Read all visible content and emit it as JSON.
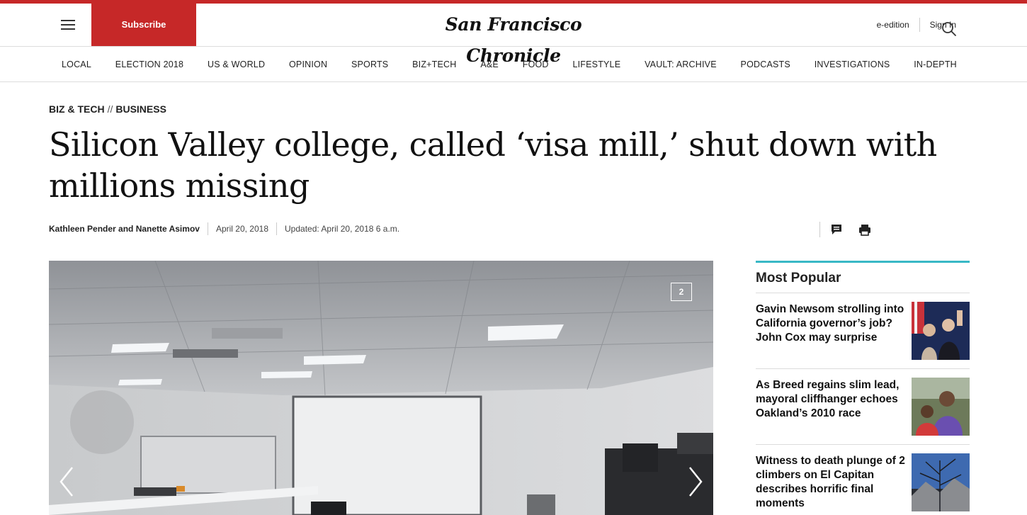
{
  "header": {
    "subscribe_label": "Subscribe",
    "logo_text": "San Francisco Chronicle",
    "edition_label": "e-edition",
    "signin_label": "Sign In",
    "accent_color": "#c62828"
  },
  "nav": {
    "items": [
      "LOCAL",
      "ELECTION 2018",
      "US & WORLD",
      "OPINION",
      "SPORTS",
      "BIZ+TECH",
      "A&E",
      "FOOD",
      "LIFESTYLE",
      "VAULT: ARCHIVE",
      "PODCASTS",
      "INVESTIGATIONS",
      "IN-DEPTH"
    ]
  },
  "article": {
    "kicker_section": "BIZ & TECH",
    "kicker_separator": "//",
    "kicker_subsection": "BUSINESS",
    "headline": "Silicon Valley college, called ‘visa mill,’ shut down with millions missing",
    "byline": "Kathleen Pender and Nanette Asimov",
    "date": "April 20, 2018",
    "updated": "Updated: April 20, 2018 6 a.m.",
    "photo_count": "2"
  },
  "sidebar": {
    "title": "Most Popular",
    "accent_color": "#38b8c5",
    "items": [
      {
        "headline": "Gavin Newsom strolling into California governor’s job? John Cox may surprise"
      },
      {
        "headline": "As Breed regains slim lead, mayoral cliffhanger echoes Oakland’s 2010 race"
      },
      {
        "headline": "Witness to death plunge of 2 climbers on El Capitan describes horrific final moments"
      }
    ]
  }
}
